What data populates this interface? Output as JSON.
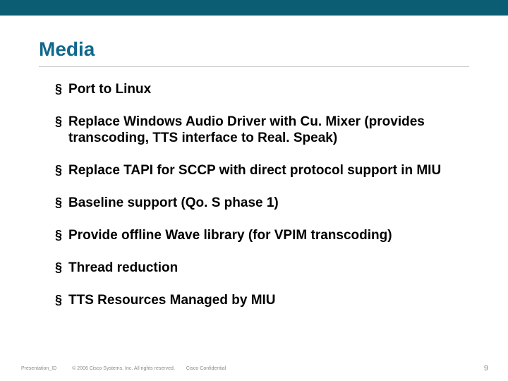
{
  "colors": {
    "top_bar": "#0a5d72",
    "title": "#10688d",
    "bullet_text": "#000000",
    "footer_text": "#8a8a8a"
  },
  "title": "Media",
  "bullets": [
    "Port to Linux",
    "Replace Windows Audio Driver with Cu. Mixer (provides transcoding, TTS interface to Real. Speak)",
    "Replace TAPI for SCCP with direct protocol support in MIU",
    "Baseline support (Qo. S phase 1)",
    "Provide offline Wave library (for VPIM transcoding)",
    "Thread reduction",
    "TTS Resources Managed by MIU"
  ],
  "footer": {
    "presentation_id": "Presentation_ID",
    "copyright": "© 2006 Cisco Systems, Inc. All rights reserved.",
    "confidential": "Cisco Confidential",
    "page_number": "9"
  }
}
